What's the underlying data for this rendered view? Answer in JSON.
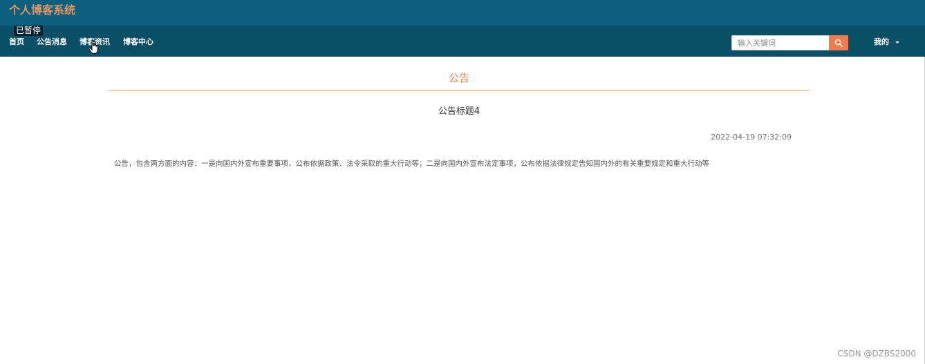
{
  "header": {
    "site_title": "个人博客系统"
  },
  "nav": {
    "items": [
      {
        "label": "首页"
      },
      {
        "label": "公告消息"
      },
      {
        "label": "博客资讯"
      },
      {
        "label": "博客中心"
      }
    ],
    "paused_label": "已暂停",
    "search": {
      "placeholder": "输入关键词",
      "value": ""
    },
    "user_menu_label": "我的"
  },
  "content": {
    "section_title": "公告",
    "notice_title": "公告标题4",
    "notice_date": "2022-04-19 07:32:09",
    "notice_body": "公告，包含两方面的内容：一是向国内外宣布重要事项，公布依据政策、法令采取的重大行动等；二是向国内外宣布法定事项，公布依据法律规定告知国内外的有关重要规定和重大行动等"
  },
  "watermark": "CSDN @DZBS2000",
  "colors": {
    "topbar": "#0c607e",
    "navbar": "#0b4f66",
    "accent": "#e0834d",
    "search_button": "#ee7d4e"
  }
}
